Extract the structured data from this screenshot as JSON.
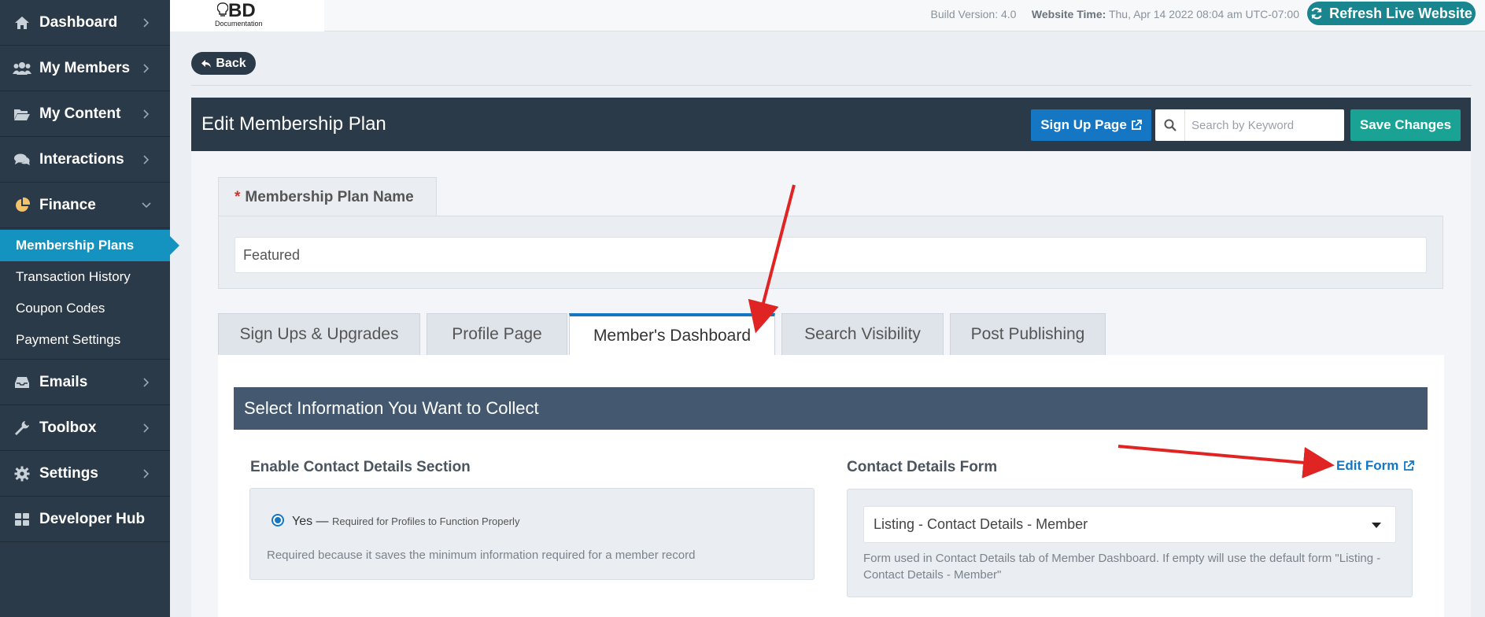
{
  "sidebar": {
    "items": [
      {
        "label": "Dashboard",
        "icon": "home-icon"
      },
      {
        "label": "My Members",
        "icon": "users-icon"
      },
      {
        "label": "My Content",
        "icon": "folder-open-icon"
      },
      {
        "label": "Interactions",
        "icon": "comments-icon"
      },
      {
        "label": "Finance",
        "icon": "pie-chart-icon"
      },
      {
        "label": "Emails",
        "icon": "inbox-icon"
      },
      {
        "label": "Toolbox",
        "icon": "wrench-icon"
      },
      {
        "label": "Settings",
        "icon": "gear-icon"
      },
      {
        "label": "Developer Hub",
        "icon": "grid-icon"
      }
    ],
    "finance_sub": [
      "Membership Plans",
      "Transaction History",
      "Coupon Codes",
      "Payment Settings"
    ],
    "active_sub": "Membership Plans"
  },
  "topbar": {
    "logo_text": "BD",
    "logo_sub": "Documentation",
    "build_label": "Build Version: 4.0",
    "time_label": "Website Time:",
    "time_value": "Thu, Apr 14 2022 08:04 am UTC-07:00",
    "refresh_label": "Refresh Live Website"
  },
  "main": {
    "back_label": "Back",
    "title": "Edit Membership Plan",
    "signup_label": "Sign Up Page",
    "search_placeholder": "Search by Keyword",
    "save_label": "Save Changes",
    "name_required_mark": "*",
    "name_label": "Membership Plan Name",
    "name_value": "Featured",
    "tabs": [
      {
        "label": "Sign Ups & Upgrades"
      },
      {
        "label": "Profile Page"
      },
      {
        "label": "Member's Dashboard"
      },
      {
        "label": "Search Visibility"
      },
      {
        "label": "Post Publishing"
      }
    ],
    "active_tab": "Member's Dashboard",
    "section_title": "Select Information You Want to Collect",
    "contact_section": {
      "label": "Enable Contact Details Section",
      "option_label": "Yes —",
      "option_note": "Required for Profiles to Function Properly",
      "help": "Required because it saves the minimum information required for a member record"
    },
    "contact_form": {
      "label": "Contact Details Form",
      "edit_label": "Edit Form",
      "selected": "Listing - Contact Details - Member",
      "help": "Form used in Contact Details tab of Member Dashboard. If empty will use the default form \"Listing - Contact Details - Member\""
    }
  },
  "colors": {
    "sidebar_bg": "#2b3a48",
    "active_blue": "#1493c0",
    "primary_blue": "#1577c4",
    "teal": "#1aa294",
    "section_bar": "#445970",
    "annotation_red": "#e02424"
  }
}
